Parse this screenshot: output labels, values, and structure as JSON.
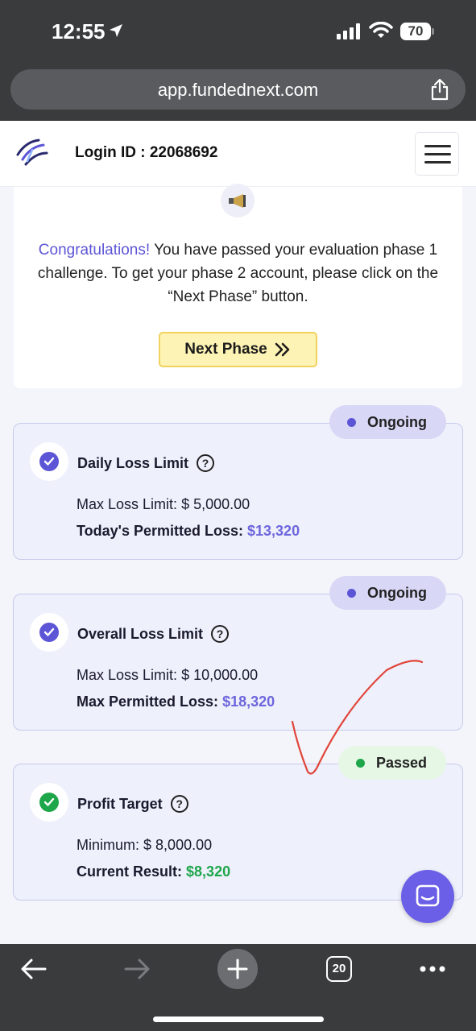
{
  "status_bar": {
    "time": "12:55",
    "battery": "70"
  },
  "browser": {
    "url": "app.fundednext.com",
    "tabs_count": "20"
  },
  "header": {
    "login_id": "Login ID : 22068692"
  },
  "congrats": {
    "highlight": "Congratulations!",
    "message": " You have passed your evaluation phase 1 challenge. To get your phase 2 account, please click on the “Next Phase” button.",
    "button_label": "Next Phase"
  },
  "cards": [
    {
      "badge": "Ongoing",
      "title": "Daily Loss Limit",
      "row1_label": "Max Loss Limit:",
      "row1_value": "$ 5,000.00",
      "row2_label": "Today's Permitted Loss:",
      "row2_value": "$13,320"
    },
    {
      "badge": "Ongoing",
      "title": "Overall Loss Limit",
      "row1_label": "Max Loss Limit:",
      "row1_value": "$ 10,000.00",
      "row2_label": "Max Permitted Loss:",
      "row2_value": "$18,320"
    },
    {
      "badge": "Passed",
      "title": "Profit Target",
      "row1_label": "Minimum:",
      "row1_value": "$ 8,000.00",
      "row2_label": "Current Result:",
      "row2_value": "$8,320"
    }
  ],
  "colors": {
    "accent": "#5c55d6",
    "passed": "#1ea64a",
    "button": "#fdf3b4"
  }
}
